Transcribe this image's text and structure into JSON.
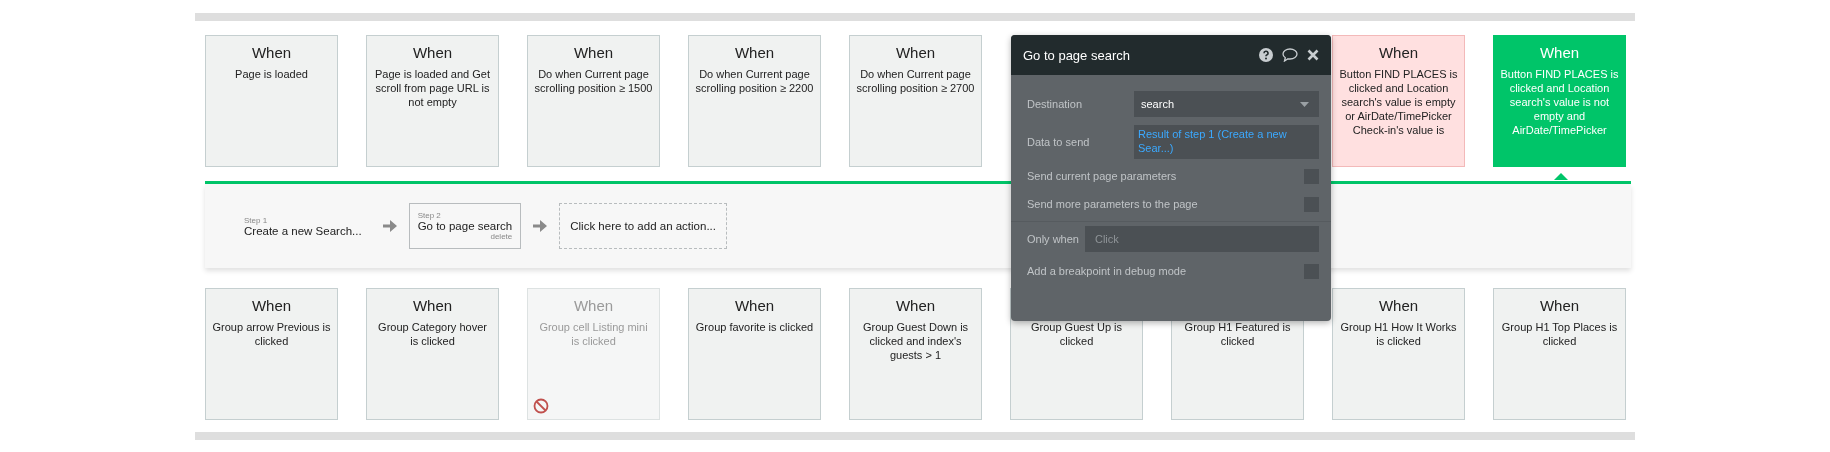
{
  "top_events": [
    {
      "title": "When",
      "condition": "Page is loaded",
      "error": false,
      "selected": false
    },
    {
      "title": "When",
      "condition": "Page is loaded and Get scroll from page URL is not empty",
      "error": false,
      "selected": false
    },
    {
      "title": "When",
      "condition": "Do when Current page scrolling position ≥ 1500",
      "error": false,
      "selected": false
    },
    {
      "title": "When",
      "condition": "Do when Current page scrolling position ≥ 2200",
      "error": false,
      "selected": false
    },
    {
      "title": "When",
      "condition": "Do when Current page scrolling position ≥ 2700",
      "error": false,
      "selected": false
    },
    {
      "title": "When",
      "condition": "Button FIND PLACES is clicked and Location search's value is empty or AirDate/TimePicker Check-in's value is",
      "error": true,
      "selected": false
    },
    {
      "title": "When",
      "condition": "Button FIND PLACES is clicked and Location search's value is not empty and AirDate/TimePicker",
      "error": false,
      "selected": true
    }
  ],
  "steps": [
    {
      "label": "Step 1",
      "action": "Create a new Search...",
      "selected": false
    },
    {
      "label": "Step 2",
      "action": "Go to page search",
      "selected": true,
      "delete": "delete"
    }
  ],
  "add_action": "Click here to add an action...",
  "bottom_events": [
    {
      "title": "When",
      "condition": "Group arrow Previous is clicked",
      "disabled": false
    },
    {
      "title": "When",
      "condition": "Group Category hover is clicked",
      "disabled": false
    },
    {
      "title": "When",
      "condition": "Group cell Listing mini is clicked",
      "disabled": true
    },
    {
      "title": "When",
      "condition": "Group favorite is clicked",
      "disabled": false
    },
    {
      "title": "When",
      "condition": "Group Guest Down is clicked and index's guests > 1",
      "disabled": false
    },
    {
      "condition": "Group Guest Up is clicked",
      "disabled": false
    },
    {
      "condition": "Group H1 Featured is clicked",
      "disabled": false
    },
    {
      "title": "When",
      "condition": "Group H1 How It Works is clicked",
      "disabled": false
    },
    {
      "title": "When",
      "condition": "Group H1 Top Places is clicked",
      "disabled": false
    }
  ],
  "panel": {
    "title": "Go to page search",
    "destination": {
      "label": "Destination",
      "value": "search"
    },
    "data_to_send": {
      "label": "Data to send",
      "value": "Result of step 1 (Create a new Sear...)"
    },
    "options": [
      {
        "label": "Send current page parameters",
        "checked": false
      },
      {
        "label": "Send more parameters to the page",
        "checked": false
      }
    ],
    "only_when": {
      "label": "Only when",
      "placeholder": "Click"
    },
    "breakpoint": {
      "label": "Add a breakpoint in debug mode",
      "checked": false
    }
  }
}
